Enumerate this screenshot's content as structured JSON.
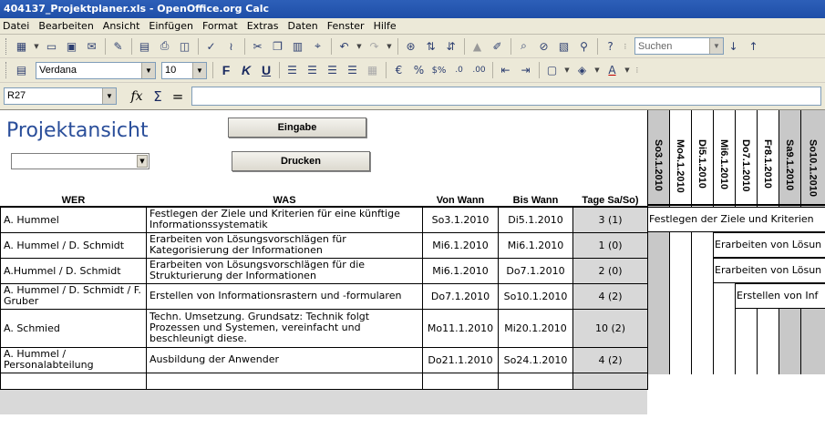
{
  "window": {
    "title": "404137_Projektplaner.xls - OpenOffice.org Calc"
  },
  "menu": [
    "Datei",
    "Bearbeiten",
    "Ansicht",
    "Einfügen",
    "Format",
    "Extras",
    "Daten",
    "Fenster",
    "Hilfe"
  ],
  "toolbar": {
    "search_placeholder": "Suchen",
    "font_name": "Verdana",
    "font_size": "10",
    "bold": "F",
    "italic": "K",
    "underline": "U"
  },
  "formula_bar": {
    "cell_ref": "R27",
    "fx": "fx",
    "sum": "Σ",
    "equals": "=",
    "content": ""
  },
  "sheet": {
    "title": "Projektansicht",
    "btn_eingabe": "Eingabe",
    "btn_drucken": "Drucken",
    "dropdown_value": "",
    "columns": {
      "wer": "WER",
      "was": "WAS",
      "von": "Von Wann",
      "bis": "Bis Wann",
      "tage": "Tage Sa/So)"
    },
    "rows": [
      {
        "wer": "A. Hummel",
        "was": "Festlegen der Ziele und Kriterien für eine künftige Informationssystematik",
        "von": "So3.1.2010",
        "bis": "Di5.1.2010",
        "tage": "3 (1)"
      },
      {
        "wer": "A. Hummel / D. Schmidt",
        "was": "Erarbeiten von Lösungsvorschlägen für Kategorisierung der Informationen",
        "von": "Mi6.1.2010",
        "bis": "Mi6.1.2010",
        "tage": "1 (0)"
      },
      {
        "wer": "A.Hummel / D. Schmidt",
        "was": "Erarbeiten von Lösungsvorschlägen für die Strukturierung der Informationen",
        "von": "Mi6.1.2010",
        "bis": "Do7.1.2010",
        "tage": "2 (0)"
      },
      {
        "wer": "A. Hummel / D. Schmidt / F. Gruber",
        "was": "Erstellen von Informationsrastern und -formularen",
        "von": "Do7.1.2010",
        "bis": "So10.1.2010",
        "tage": "4 (2)"
      },
      {
        "wer": "A. Schmied",
        "was": "Techn. Umsetzung. Grundsatz: Technik folgt Prozessen und Systemen, vereinfacht und beschleunigt diese.",
        "von": "Mo11.1.2010",
        "bis": "Mi20.1.2010",
        "tage": "10 (2)"
      },
      {
        "wer": "A. Hummel / Personalabteilung",
        "was": "Ausbildung der Anwender",
        "von": "Do21.1.2010",
        "bis": "So24.1.2010",
        "tage": "4 (2)"
      }
    ],
    "calendar_days": [
      {
        "label": "So3.1.2010",
        "weekend": true
      },
      {
        "label": "Mo4.1.2010",
        "weekend": false
      },
      {
        "label": "Di5.1.2010",
        "weekend": false
      },
      {
        "label": "Mi6.1.2010",
        "weekend": false
      },
      {
        "label": "Do7.1.2010",
        "weekend": false
      },
      {
        "label": "Fr8.1.2010",
        "weekend": false
      },
      {
        "label": "Sa9.1.2010",
        "weekend": true
      },
      {
        "label": "So10.1.2010",
        "weekend": true
      }
    ],
    "bars": [
      "Festlegen der Ziele und Kriterien",
      "Erarbeiten von Lösun",
      "Erarbeiten von Lösun",
      "Erstellen von Inf"
    ]
  }
}
